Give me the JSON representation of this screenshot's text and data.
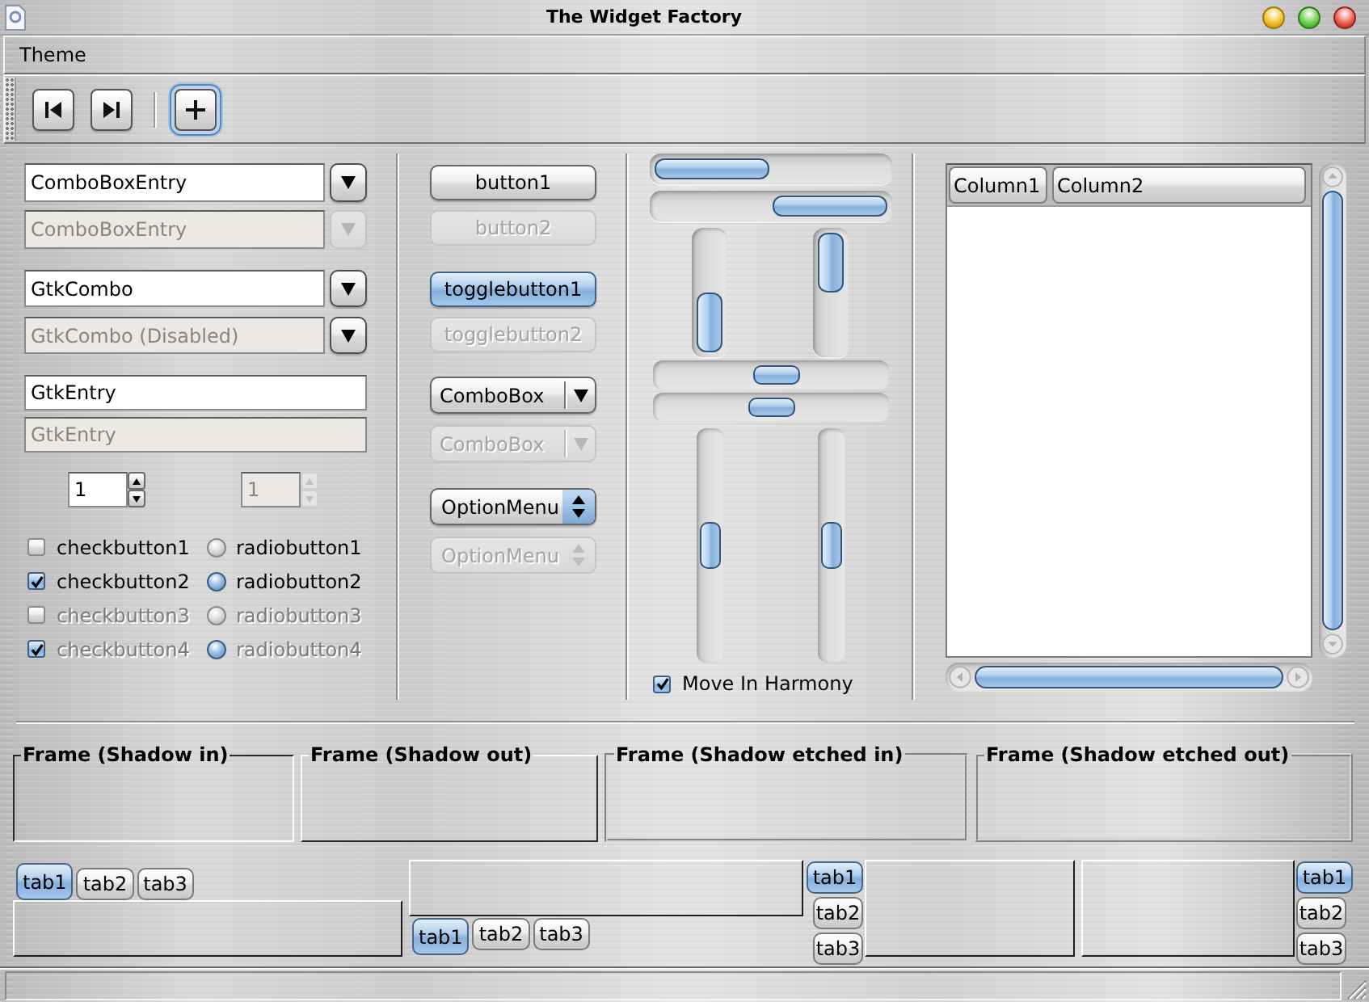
{
  "window": {
    "title": "The Widget Factory"
  },
  "menu_bar": [
    {
      "label": "Theme"
    }
  ],
  "toolbar": [
    {
      "kind": "button",
      "focused": false
    },
    {
      "kind": "button",
      "focused": false
    },
    {
      "kind": "separator"
    },
    {
      "kind": "button",
      "focused": true
    }
  ],
  "combo_box_entries": [
    {
      "value": "ComboBoxEntry",
      "disabled": false,
      "button_disabled": false
    },
    {
      "value": "ComboBoxEntry",
      "disabled": true,
      "button_disabled": true
    }
  ],
  "gtk_combos": [
    {
      "value": "GtkCombo",
      "disabled": false,
      "button_disabled": false
    },
    {
      "value": "GtkCombo (Disabled)",
      "disabled": true,
      "button_disabled": false
    }
  ],
  "entries": [
    {
      "value": "GtkEntry",
      "disabled": false
    },
    {
      "value": "GtkEntry",
      "disabled": true
    }
  ],
  "spin_buttons": [
    {
      "value": "1",
      "disabled": false
    },
    {
      "value": "1",
      "disabled": true
    }
  ],
  "check_buttons": [
    {
      "label": "checkbutton1",
      "checked": false,
      "disabled": false
    },
    {
      "label": "checkbutton2",
      "checked": true,
      "disabled": false
    },
    {
      "label": "checkbutton3",
      "checked": false,
      "disabled": true
    },
    {
      "label": "checkbutton4",
      "checked": true,
      "disabled": true
    }
  ],
  "radio_buttons": [
    {
      "label": "radiobutton1",
      "selected": false,
      "disabled": false
    },
    {
      "label": "radiobutton2",
      "selected": true,
      "disabled": false
    },
    {
      "label": "radiobutton3",
      "selected": false,
      "disabled": true
    },
    {
      "label": "radiobutton4",
      "selected": true,
      "disabled": true
    }
  ],
  "buttons": [
    {
      "label": "button1",
      "disabled": false
    },
    {
      "label": "button2",
      "disabled": true
    }
  ],
  "toggle_buttons": [
    {
      "label": "togglebutton1",
      "active": true,
      "disabled": false
    },
    {
      "label": "togglebutton2",
      "active": false,
      "disabled": true
    }
  ],
  "combo_boxes": [
    {
      "value": "ComboBox",
      "disabled": false
    },
    {
      "value": "ComboBox",
      "disabled": true
    }
  ],
  "option_menus": [
    {
      "value": "OptionMenu",
      "disabled": false
    },
    {
      "value": "OptionMenu",
      "disabled": true
    }
  ],
  "hscales": [
    {
      "level": 0.53
    },
    {
      "level": 0.5
    }
  ],
  "vscales": [
    {
      "level": 0.5
    },
    {
      "level": 0.5
    }
  ],
  "move_in_harmony": {
    "label": "Move In Harmony",
    "checked": true
  },
  "tree_view": {
    "columns": [
      {
        "label": "Column1"
      },
      {
        "label": "Column2"
      }
    ]
  },
  "frames": [
    {
      "label": "Frame (Shadow in)",
      "kind": "in"
    },
    {
      "label": "Frame (Shadow out)",
      "kind": "out"
    },
    {
      "label": "Frame (Shadow etched in)",
      "kind": "etched-in"
    },
    {
      "label": "Frame (Shadow etched out)",
      "kind": "etched-out"
    }
  ],
  "notebooks": [
    {
      "kind": "top",
      "tabs": [
        {
          "label": "tab1",
          "selected": true
        },
        {
          "label": "tab2",
          "selected": false
        },
        {
          "label": "tab3",
          "selected": false
        }
      ]
    },
    {
      "kind": "bottom",
      "tabs": [
        {
          "label": "tab1",
          "selected": true
        },
        {
          "label": "tab2",
          "selected": false
        },
        {
          "label": "tab3",
          "selected": false
        }
      ]
    },
    {
      "kind": "left",
      "tabs": [
        {
          "label": "tab1",
          "selected": true
        },
        {
          "label": "tab2",
          "selected": false
        },
        {
          "label": "tab3",
          "selected": false
        }
      ]
    },
    {
      "kind": "right",
      "tabs": [
        {
          "label": "tab1",
          "selected": true
        },
        {
          "label": "tab2",
          "selected": false
        },
        {
          "label": "tab3",
          "selected": false
        }
      ]
    }
  ]
}
